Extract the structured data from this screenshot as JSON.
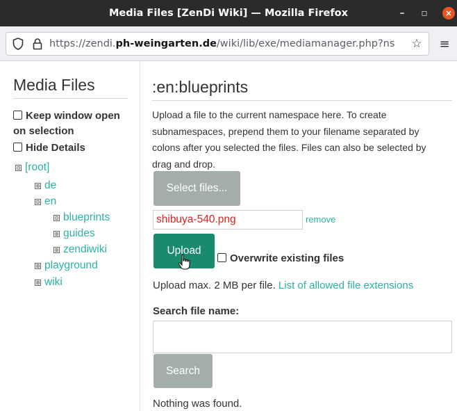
{
  "window": {
    "title": "Media Files [ZenDi Wiki] — Mozilla Firefox"
  },
  "browser": {
    "url_prefix": "https://zendi.",
    "url_domain": "ph-weingarten.de",
    "url_path": "/wiki/lib/exe/mediamanager.php?ns"
  },
  "sidebar": {
    "title": "Media Files",
    "options": {
      "keep_open_line1": "Keep window open",
      "keep_open_line2": "on selection",
      "hide_details": "Hide Details"
    },
    "tree": [
      {
        "label": "[root]",
        "toggle": "⊟"
      },
      {
        "label": "de",
        "toggle": "⊞"
      },
      {
        "label": "en",
        "toggle": "⊟"
      },
      {
        "label": "blueprints",
        "toggle": "⊟"
      },
      {
        "label": "guides",
        "toggle": "⊞"
      },
      {
        "label": "zendiwiki",
        "toggle": "⊞"
      },
      {
        "label": "playground",
        "toggle": "⊞"
      },
      {
        "label": "wiki",
        "toggle": "⊞"
      }
    ]
  },
  "main": {
    "namespace_title": ":en:blueprints",
    "description": "Upload a file to the current namespace here. To create subnamespaces, prepend them to your filename separated by colons after you selected the files. Files can also be selected by drag and drop.",
    "select_button": "Select files...",
    "selected_file": "shibuya-540.png",
    "remove_link": "remove",
    "upload_button": "Upload",
    "overwrite_label": "Overwrite existing files",
    "limit_text": "Upload max. 2 MB per file. ",
    "extensions_link": "List of allowed file extensions",
    "search_label": "Search file name:",
    "search_value": "",
    "search_button": "Search",
    "result_text": "Nothing was found."
  },
  "colors": {
    "accent": "#2ab3a1",
    "upload_button": "#1a8a6f",
    "disabled_button": "#a3aeaa",
    "filename_text": "#e02020"
  }
}
